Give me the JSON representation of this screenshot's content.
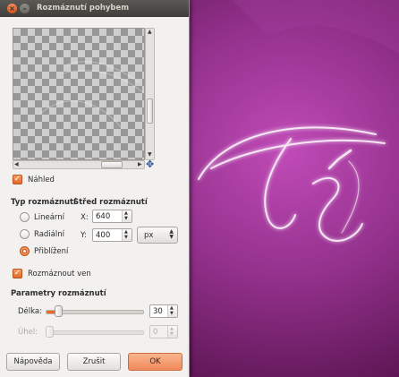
{
  "window": {
    "title": "Rozmáznutí pohybem"
  },
  "preview": {
    "checkbox_label": "Náhled",
    "checked": true
  },
  "blur_type": {
    "heading": "Typ rozmáznutí",
    "options": [
      {
        "label": "Lineární",
        "selected": false
      },
      {
        "label": "Radiální",
        "selected": false
      },
      {
        "label": "Přiblížení",
        "selected": true
      }
    ]
  },
  "center": {
    "heading": "Střed rozmáznutí",
    "x_label": "X:",
    "x_value": "640",
    "y_label": "Y:",
    "y_value": "400",
    "unit": "px"
  },
  "blur_outward": {
    "label": "Rozmáznout ven",
    "checked": true
  },
  "params": {
    "heading": "Parametry rozmáznutí",
    "length_label": "Délka:",
    "length_value": "30",
    "length_fraction": 0.1,
    "angle_label": "Úhel:",
    "angle_value": "0",
    "angle_fraction": 0.0
  },
  "buttons": {
    "help": "Nápověda",
    "cancel": "Zrušit",
    "ok": "OK"
  },
  "colors": {
    "accent": "#e8692b",
    "background": "#7a1f6e",
    "dialog": "#f2f1f0"
  },
  "icons": {
    "close": "close-icon",
    "minimize": "minimize-icon",
    "navigate": "navigate-icon"
  }
}
